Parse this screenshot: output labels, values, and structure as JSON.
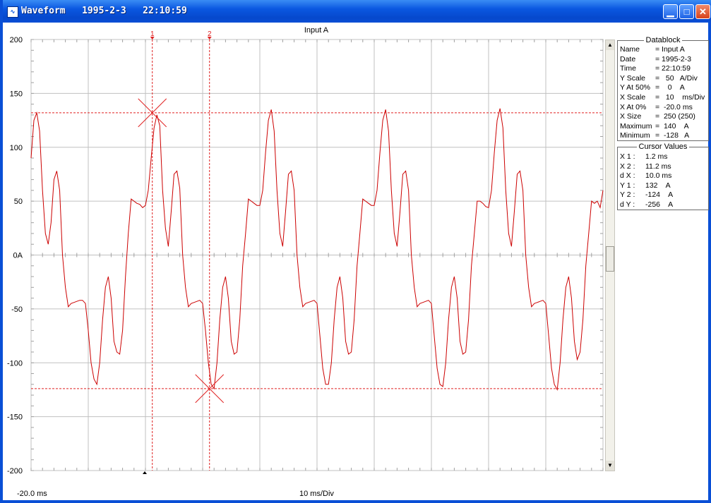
{
  "window": {
    "title": "Waveform   1995-2-3   22:10:59",
    "icon": "waveform-app-icon",
    "controls": [
      "minimize",
      "maximize",
      "close"
    ]
  },
  "plot": {
    "title": "Input A",
    "y_tick_labels": [
      "200",
      "150",
      "100",
      "50",
      "0A",
      "-50",
      "-100",
      "-150",
      "-200"
    ],
    "x_start_label": "-20.0 ms",
    "x_scale_label": "10 ms/Div",
    "cursor1_label": "1",
    "cursor2_label": "2",
    "trace_color": "#cc0000",
    "cursor_color": "#e02020"
  },
  "chart_data": {
    "type": "line",
    "title": "Input A",
    "xlabel": "10 ms/Div",
    "ylabel": "",
    "xlim": [
      -20.0,
      80.0
    ],
    "ylim": [
      -200,
      200
    ],
    "grid": true,
    "series": [
      {
        "name": "Input A",
        "x": [
          -20.0,
          -19.5,
          -19.0,
          -18.5,
          -18.0,
          -17.5,
          -17.0,
          -16.5,
          -16.0,
          -15.5,
          -15.0,
          -14.5,
          -14.0,
          -13.5,
          -13.0,
          -12.5,
          -12.0,
          -11.5,
          -11.0,
          -10.5,
          -10.0,
          -9.5,
          -9.0,
          -8.5,
          -8.0,
          -7.5,
          -7.0,
          -6.5,
          -6.0,
          -5.5,
          -5.0,
          -4.5,
          -4.0,
          -3.5,
          -3.0,
          -2.5,
          -2.0,
          -1.5,
          -1.0,
          -0.5,
          0.0,
          0.5,
          1.0,
          1.5,
          2.0,
          2.5,
          3.0,
          3.5,
          4.0,
          4.5,
          5.0,
          5.5,
          6.0,
          6.5,
          7.0,
          7.5,
          8.0,
          8.5,
          9.0,
          9.5,
          10.0,
          10.5,
          11.0,
          11.5,
          12.0,
          12.5,
          13.0,
          13.5,
          14.0,
          14.5,
          15.0,
          15.5,
          16.0,
          16.5,
          17.0,
          17.5,
          18.0,
          18.5,
          19.0,
          19.5,
          20.0,
          20.5,
          21.0,
          21.5,
          22.0,
          22.5,
          23.0,
          23.5,
          24.0,
          24.5,
          25.0,
          25.5,
          26.0,
          26.5,
          27.0,
          27.5,
          28.0,
          28.5,
          29.0,
          29.5,
          30.0,
          30.5,
          31.0,
          31.5,
          32.0,
          32.5,
          33.0,
          33.5,
          34.0,
          34.5,
          35.0,
          35.5,
          36.0,
          36.5,
          37.0,
          37.5,
          38.0,
          38.5,
          39.0,
          39.5,
          40.0,
          40.5,
          41.0,
          41.5,
          42.0,
          42.5,
          43.0,
          43.5,
          44.0,
          44.5,
          45.0,
          45.5,
          46.0,
          46.5,
          47.0,
          47.5,
          48.0,
          48.5,
          49.0,
          49.5,
          50.0,
          50.5,
          51.0,
          51.5,
          52.0,
          52.5,
          53.0,
          53.5,
          54.0,
          54.5,
          55.0,
          55.5,
          56.0,
          56.5,
          57.0,
          57.5,
          58.0,
          58.5,
          59.0,
          59.5,
          60.0,
          60.5,
          61.0,
          61.5,
          62.0,
          62.5,
          63.0,
          63.5,
          64.0,
          64.5,
          65.0,
          65.5,
          66.0,
          66.5,
          67.0,
          67.5,
          68.0,
          68.5,
          69.0,
          69.5,
          70.0,
          70.5,
          71.0,
          71.5,
          72.0,
          72.5,
          73.0,
          73.5,
          74.0,
          74.5,
          75.0,
          75.5,
          76.0,
          76.5,
          77.0,
          77.5,
          78.0,
          78.5,
          79.0,
          79.5,
          80.0
        ],
        "y": [
          90,
          125,
          132,
          115,
          60,
          20,
          10,
          30,
          70,
          78,
          60,
          0,
          -30,
          -48,
          -45,
          -44,
          -43,
          -42,
          -42,
          -45,
          -70,
          -100,
          -115,
          -120,
          -100,
          -60,
          -30,
          -20,
          -40,
          -80,
          -90,
          -92,
          -70,
          -20,
          20,
          52,
          50,
          48,
          47,
          44,
          46,
          60,
          90,
          118,
          130,
          120,
          60,
          25,
          8,
          40,
          75,
          78,
          62,
          0,
          -30,
          -48,
          -45,
          -44,
          -43,
          -42,
          -45,
          -70,
          -100,
          -120,
          -124,
          -100,
          -60,
          -30,
          -20,
          -40,
          -80,
          -92,
          -90,
          -60,
          -10,
          20,
          52,
          50,
          48,
          46,
          46,
          60,
          95,
          125,
          135,
          115,
          60,
          20,
          8,
          40,
          75,
          78,
          60,
          0,
          -30,
          -48,
          -45,
          -44,
          -43,
          -42,
          -45,
          -75,
          -105,
          -120,
          -120,
          -100,
          -60,
          -30,
          -20,
          -40,
          -80,
          -92,
          -90,
          -60,
          -10,
          20,
          52,
          50,
          48,
          46,
          46,
          60,
          95,
          125,
          135,
          115,
          60,
          20,
          8,
          40,
          75,
          78,
          60,
          0,
          -30,
          -48,
          -45,
          -44,
          -43,
          -42,
          -45,
          -75,
          -105,
          -120,
          -122,
          -100,
          -60,
          -30,
          -20,
          -40,
          -80,
          -92,
          -90,
          -60,
          -10,
          20,
          50,
          50,
          48,
          45,
          44,
          60,
          95,
          125,
          136,
          118,
          60,
          20,
          8,
          40,
          75,
          78,
          60,
          0,
          -30,
          -48,
          -45,
          -44,
          -43,
          -42,
          -45,
          -75,
          -105,
          -120,
          -125,
          -100,
          -60,
          -30,
          -20,
          -40,
          -80,
          -97,
          -90,
          -60,
          -10,
          20,
          50,
          48,
          50,
          44,
          60
        ]
      }
    ],
    "cursors": {
      "x1": 1.2,
      "x2": 11.2,
      "y1": 132,
      "y2": -124
    }
  },
  "datablock": {
    "title": "Datablock",
    "rows": [
      {
        "label": "Name",
        "value": "= Input A"
      },
      {
        "label": "Date",
        "value": "= 1995-2-3"
      },
      {
        "label": "Time",
        "value": "= 22:10:59"
      },
      {
        "label": "Y Scale",
        "value": "=   50   A/Div"
      },
      {
        "label": "Y At 50%",
        "value": "=    0    A"
      },
      {
        "label": "X Scale",
        "value": "=   10    ms/Div"
      },
      {
        "label": "X At 0%",
        "value": "=  -20.0 ms"
      },
      {
        "label": "X Size",
        "value": "=  250 (250)"
      },
      {
        "label": "Maximum",
        "value": "=  140    A"
      },
      {
        "label": "Minimum",
        "value": "=  -128   A"
      }
    ]
  },
  "cursor_values": {
    "title": "Cursor Values",
    "rows": [
      {
        "label": "X 1 :",
        "value": "1.2 ms"
      },
      {
        "label": "X 2 :",
        "value": "11.2 ms"
      },
      {
        "label": "d X :",
        "value": "10.0 ms"
      },
      {
        "label": "Y 1 :",
        "value": "132    A"
      },
      {
        "label": "Y 2 :",
        "value": "-124    A"
      },
      {
        "label": "d Y :",
        "value": "-256    A"
      }
    ]
  }
}
